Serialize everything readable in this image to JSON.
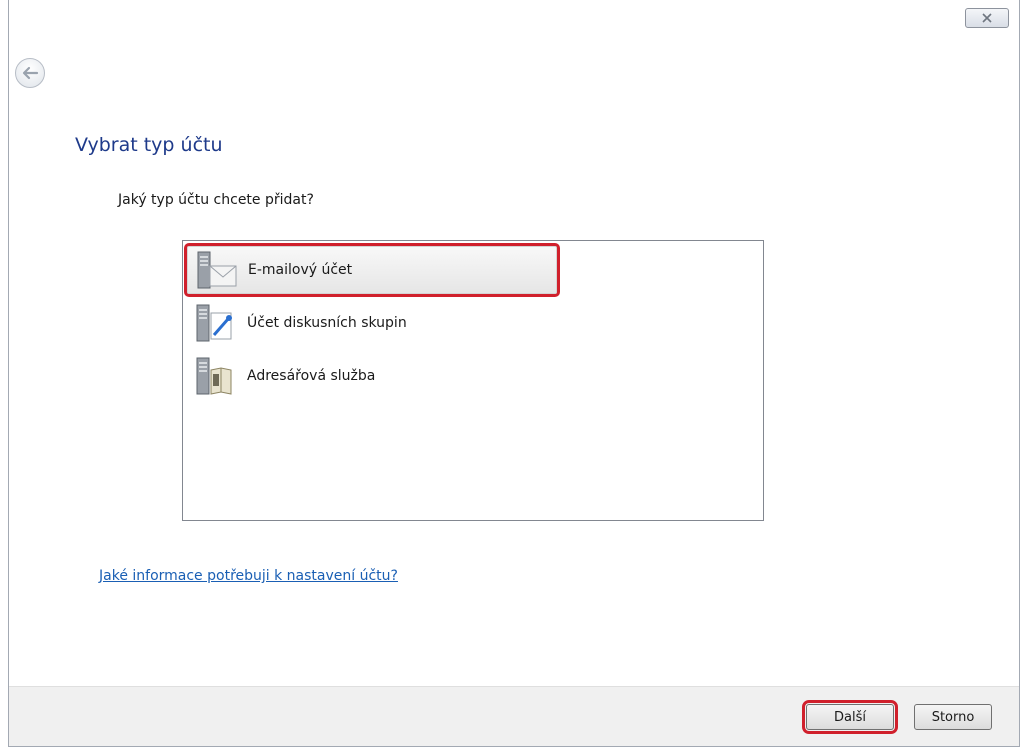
{
  "window": {
    "close_glyph": "☒",
    "title": "Vybrat typ účtu",
    "question": "Jaký typ účtu chcete přidat?"
  },
  "account_types": [
    {
      "label": "E-mailový účet",
      "icon": "email-server-icon",
      "selected": true
    },
    {
      "label": "Účet diskusních skupin",
      "icon": "newsgroup-server-icon",
      "selected": false
    },
    {
      "label": "Adresářová služba",
      "icon": "directory-service-icon",
      "selected": false
    }
  ],
  "help_link": "Jaké informace potřebuji k nastavení účtu?",
  "footer": {
    "next_label": "Další",
    "cancel_label": "Storno"
  },
  "colors": {
    "title": "#1e3a8a",
    "link": "#1a5fb4",
    "highlight": "#d0202c"
  }
}
